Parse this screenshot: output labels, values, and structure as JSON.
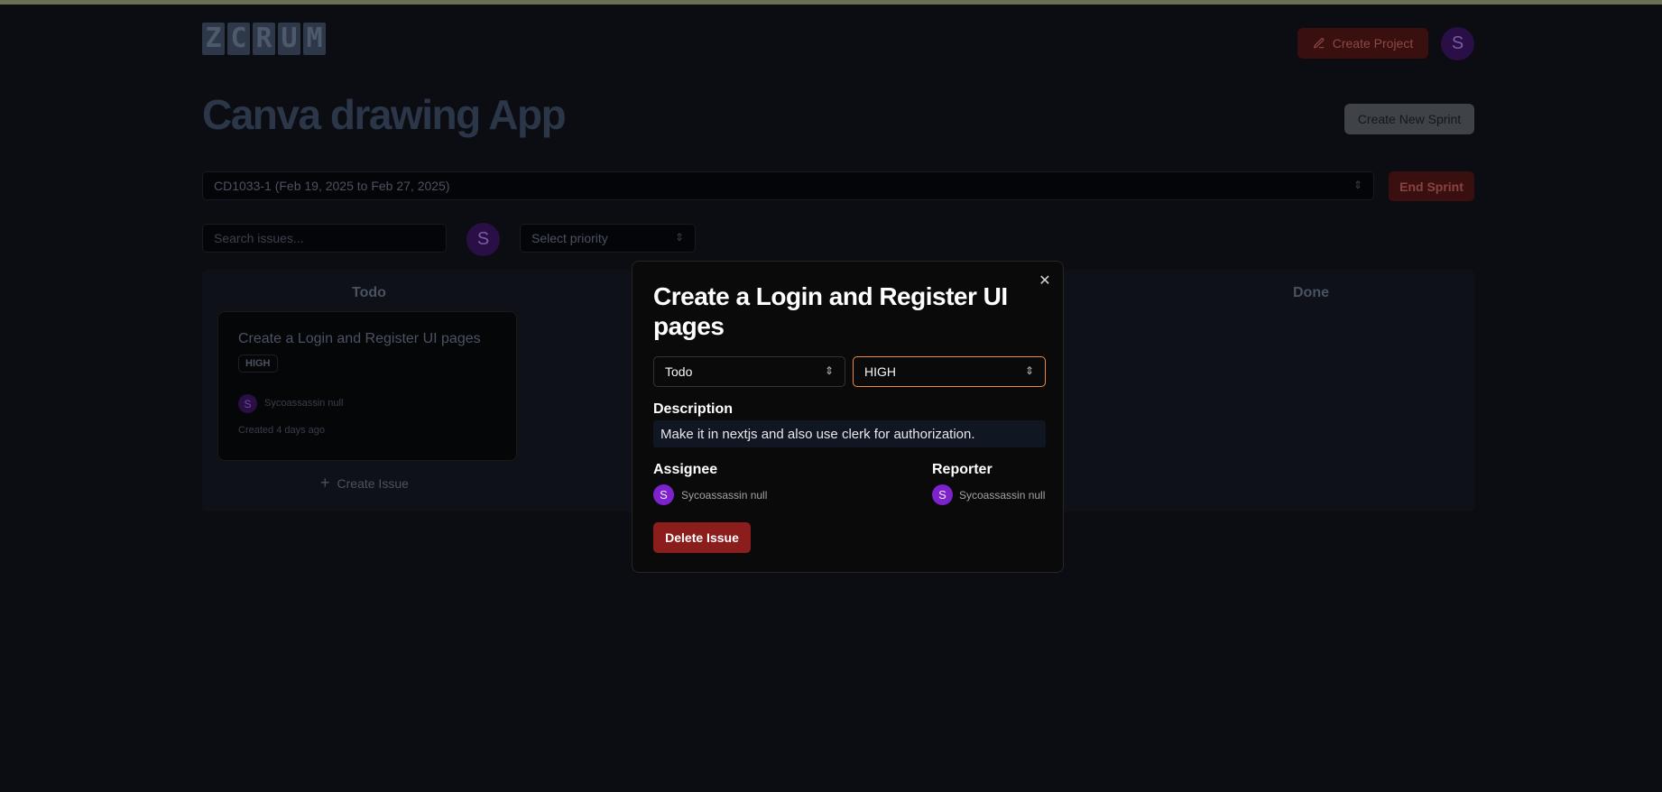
{
  "header": {
    "logo_letters": [
      "Z",
      "C",
      "R",
      "U",
      "M"
    ],
    "create_project_label": "Create Project",
    "user_initial": "S"
  },
  "project": {
    "title": "Canva drawing App",
    "create_sprint_label": "Create New Sprint"
  },
  "sprint": {
    "selected": "CD1033-1 (Feb 19, 2025 to Feb 27, 2025)",
    "end_label": "End Sprint"
  },
  "filters": {
    "search_placeholder": "Search issues...",
    "assignee_initial": "S",
    "priority_placeholder": "Select priority"
  },
  "board": {
    "columns": [
      "Todo",
      "Done"
    ],
    "card": {
      "title": "Create a Login and Register UI pages",
      "priority": "HIGH",
      "assignee_initial": "S",
      "assignee_name": "Sycoassassin null",
      "created": "Created 4 days ago"
    },
    "create_issue_label": "Create Issue"
  },
  "modal": {
    "title": "Create a Login and Register UI pages",
    "status": "Todo",
    "priority": "HIGH",
    "description_label": "Description",
    "description": "Make it in nextjs and also use clerk for authorization.",
    "assignee_label": "Assignee",
    "assignee_initial": "S",
    "assignee_name": "Sycoassassin null",
    "reporter_label": "Reporter",
    "reporter_initial": "S",
    "reporter_name": "Sycoassassin null",
    "delete_label": "Delete Issue",
    "close_icon": "close-icon"
  },
  "colors": {
    "accent_orange": "#f08a3e",
    "danger": "#8b1d1d",
    "avatar_purple": "#7e22ce"
  }
}
